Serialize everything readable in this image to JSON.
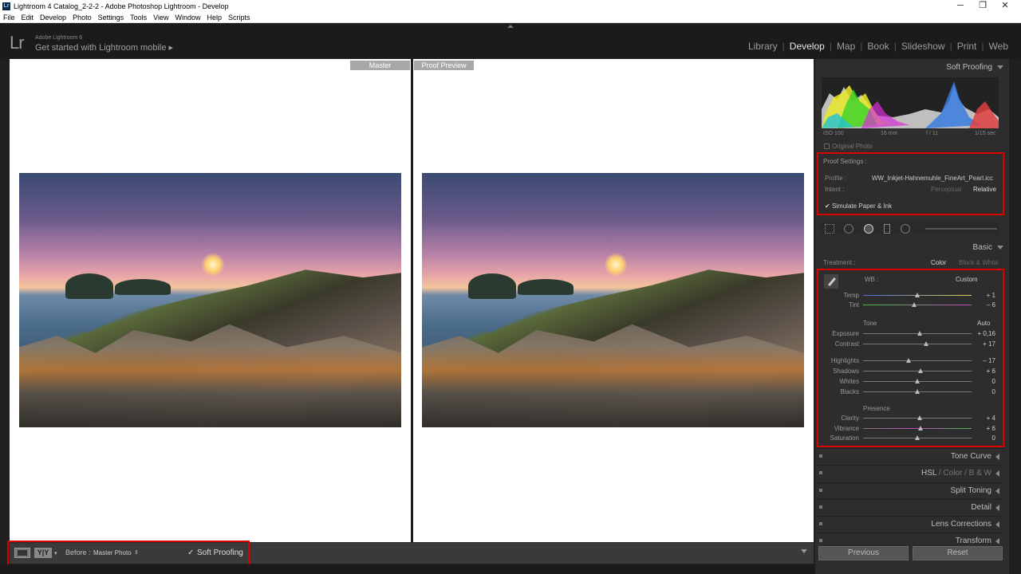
{
  "window": {
    "title": "Lightroom 4 Catalog_2-2-2 - Adobe Photoshop Lightroom - Develop",
    "minimize": "─",
    "maximize": "❐",
    "close": "✕"
  },
  "menu": [
    "File",
    "Edit",
    "Develop",
    "Photo",
    "Settings",
    "Tools",
    "View",
    "Window",
    "Help",
    "Scripts"
  ],
  "identity": {
    "logo": "Lr",
    "product": "Adobe Lightroom 6",
    "mobile_text": "Get started with Lightroom mobile ▸"
  },
  "modules": [
    "Library",
    "Develop",
    "Map",
    "Book",
    "Slideshow",
    "Print",
    "Web"
  ],
  "active_module": "Develop",
  "canvas": {
    "left_label": "Master",
    "right_label": "Proof Preview"
  },
  "toolbar": {
    "yy_label": "Y|Y",
    "before_label": "Before :",
    "before_value": "Master Photo",
    "soft_proofing_check": "✓",
    "soft_proofing_label": "Soft Proofing"
  },
  "right_panel": {
    "soft_proofing_header": "Soft Proofing",
    "histogram_meta": {
      "iso": "ISO 100",
      "focal": "16 mm",
      "aperture": "f / 11",
      "shutter": "1/15 sec"
    },
    "original_photo": "Original Photo",
    "proof_settings": {
      "title": "Proof Settings :",
      "profile_label": "Profile :",
      "profile_value": "WW_Inkjet-Hahnemuhle_FineArt_Pearl.icc",
      "intent_label": "Intent :",
      "intent_perceptual": "Perceptual",
      "intent_relative": "Relative",
      "simulate_label": "Simulate Paper & Ink"
    },
    "basic": {
      "header": "Basic",
      "treatment_label": "Treatment :",
      "treatment_color": "Color",
      "treatment_bw": "Black & White",
      "wb_label": "WB :",
      "wb_value": "Custom",
      "tone_label": "Tone",
      "auto_label": "Auto",
      "presence_label": "Presence",
      "sliders": [
        {
          "label": "Temp",
          "value": "+ 1",
          "pos": 0.5
        },
        {
          "label": "Tint",
          "value": "– 6",
          "pos": 0.47
        },
        {
          "label": "Exposure",
          "value": "+ 0,16",
          "pos": 0.52
        },
        {
          "label": "Contrast",
          "value": "+ 17",
          "pos": 0.58
        },
        {
          "label": "Highlights",
          "value": "– 17",
          "pos": 0.42
        },
        {
          "label": "Shadows",
          "value": "+ 6",
          "pos": 0.53
        },
        {
          "label": "Whites",
          "value": "0",
          "pos": 0.5
        },
        {
          "label": "Blacks",
          "value": "0",
          "pos": 0.5
        },
        {
          "label": "Clarity",
          "value": "+ 4",
          "pos": 0.52
        },
        {
          "label": "Vibrance",
          "value": "+ 6",
          "pos": 0.53
        },
        {
          "label": "Saturation",
          "value": "0",
          "pos": 0.5
        }
      ]
    },
    "collapsed": [
      {
        "label": "Tone Curve"
      },
      {
        "label": "HSL",
        "extra1": "Color",
        "extra2": "B & W"
      },
      {
        "label": "Split Toning"
      },
      {
        "label": "Detail"
      },
      {
        "label": "Lens Corrections"
      },
      {
        "label": "Transform"
      }
    ],
    "previous_button": "Previous",
    "reset_button": "Reset"
  }
}
